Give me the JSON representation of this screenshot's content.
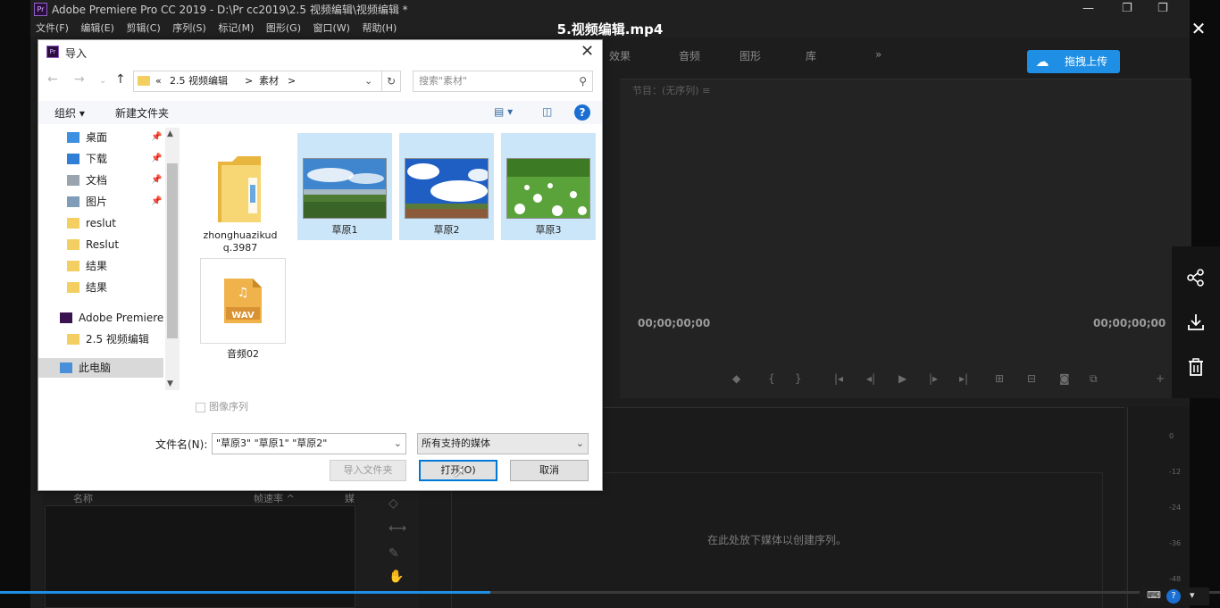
{
  "premiere": {
    "title": "Adobe Premiere Pro CC 2019 - D:\\Pr cc2019\\2.5 视频编辑\\视频编辑 *",
    "menu": [
      "文件(F)",
      "编辑(E)",
      "剪辑(C)",
      "序列(S)",
      "标记(M)",
      "图形(G)",
      "窗口(W)",
      "帮助(H)"
    ],
    "tabs": [
      "效果",
      "音频",
      "图形",
      "库",
      "»"
    ],
    "monitor_label": "节目：(无序列) ≡",
    "timecode_left": "00;00;00;00",
    "timecode_right": "00;00;00;00",
    "drop_hint": "在此处放下媒体以创建序列。",
    "project_cols": [
      "名称",
      "帧速率 ^",
      "媒"
    ],
    "meter_ticks": [
      "0",
      "-12",
      "-24",
      "-36",
      "-48"
    ]
  },
  "player": {
    "video_title": "5.视频编辑.mp4",
    "upload_label": "拖拽上传",
    "progress_fraction": 0.402
  },
  "dialog": {
    "title": "导入",
    "breadcrumb": [
      "«",
      "2.5 视频编辑",
      ">",
      "素材",
      ">"
    ],
    "search_placeholder": "搜索\"素材\"",
    "organize_label": "组织 ▾",
    "new_folder_label": "新建文件夹",
    "nav": [
      {
        "label": "桌面",
        "pinned": true,
        "icon": "desktop-icon"
      },
      {
        "label": "下载",
        "pinned": true,
        "icon": "download-icon"
      },
      {
        "label": "文档",
        "pinned": true,
        "icon": "document-icon"
      },
      {
        "label": "图片",
        "pinned": true,
        "icon": "picture-icon"
      },
      {
        "label": "reslut",
        "pinned": false,
        "icon": "folder-icon"
      },
      {
        "label": "Reslut",
        "pinned": false,
        "icon": "folder-icon"
      },
      {
        "label": "结果",
        "pinned": false,
        "icon": "folder-icon"
      },
      {
        "label": "结果",
        "pinned": false,
        "icon": "folder-icon"
      },
      {
        "label": "Adobe Premiere",
        "pinned": false,
        "icon": "premiere-icon"
      },
      {
        "label": "2.5 视频编辑",
        "pinned": false,
        "icon": "folder-icon"
      },
      {
        "label": "此电脑",
        "pinned": false,
        "icon": "computer-icon"
      }
    ],
    "files": [
      {
        "name": "zhonghuazikud q.3987",
        "type": "folder",
        "selected": false
      },
      {
        "name": "草原1",
        "type": "image",
        "selected": true
      },
      {
        "name": "草原2",
        "type": "image",
        "selected": true
      },
      {
        "name": "草原3",
        "type": "image",
        "selected": true
      },
      {
        "name": "音频02",
        "type": "wav",
        "selected": false
      }
    ],
    "wav_label": "WAV",
    "image_sequence_label": "图像序列",
    "filename_label": "文件名(N):",
    "filename_value": "\"草原3\" \"草原1\" \"草原2\"",
    "filetype_value": "所有支持的媒体",
    "import_folder_label": "导入文件夹",
    "open_label": "打开(O)",
    "cancel_label": "取消"
  }
}
